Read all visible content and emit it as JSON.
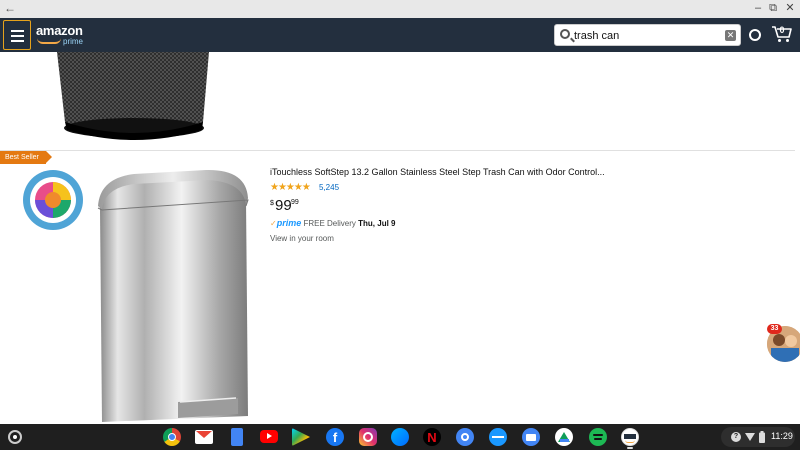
{
  "header": {
    "logo_text": "amazon",
    "logo_sub": "prime",
    "search": {
      "value": "trash can",
      "clear_icon": "close-icon"
    },
    "cart_count": "0"
  },
  "product": {
    "badge": "Best Seller",
    "title": "iTouchless SoftStep 13.2 Gallon Stainless Steel Step Trash Can with Odor Control...",
    "rating": 4.5,
    "stars": "★★★★★",
    "rating_count": "5,245",
    "price": {
      "symbol": "$",
      "whole": "99",
      "fraction": "99"
    },
    "delivery": {
      "check": "✓",
      "prime_word": "prime",
      "label": "FREE Delivery",
      "date": "Thu, Jul 9"
    },
    "view_in_room": "View in your room"
  },
  "floating_bubble": {
    "count": "33"
  },
  "shelf": {
    "apps": [
      "Chrome",
      "Gmail",
      "Docs",
      "YouTube",
      "Play Store",
      "Facebook",
      "Instagram",
      "Messenger",
      "Netflix",
      "Settings",
      "Prime Video",
      "Files",
      "Google Drive",
      "Spotify",
      "Amazon"
    ],
    "clock": "11:29"
  },
  "colors": {
    "header_bg": "#232f3e",
    "accent_orange": "#e47911",
    "star": "#f0a41c",
    "link": "#0066c0",
    "prime_blue": "#1a98ff"
  }
}
